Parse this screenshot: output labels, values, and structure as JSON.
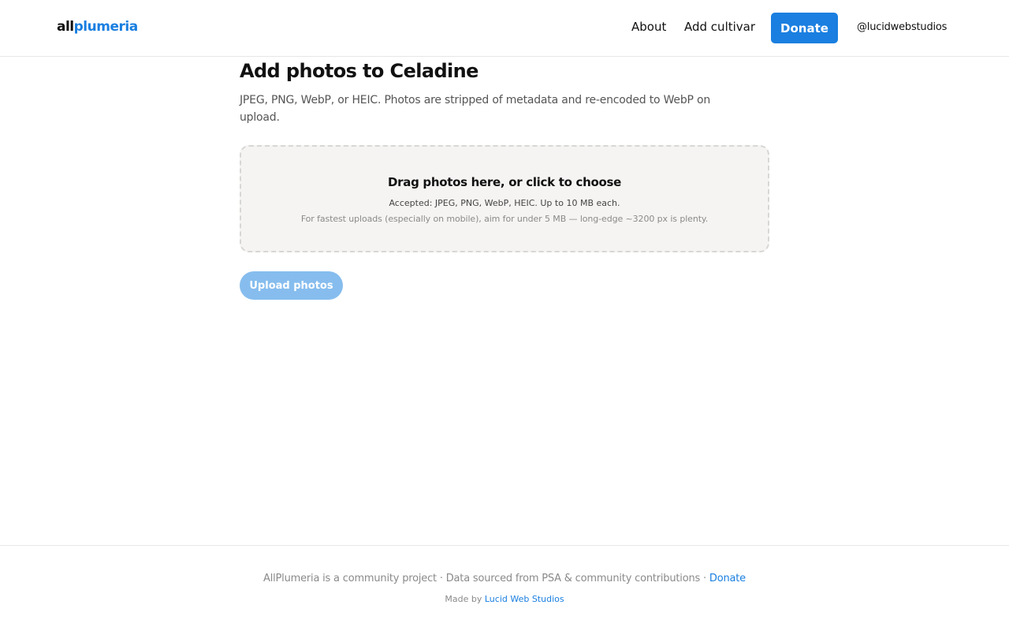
{
  "header": {
    "logo_prefix": "all",
    "logo_brand": "plumeria",
    "nav": {
      "about": "About",
      "add_cultivar": "Add cultivar",
      "donate": "Donate"
    },
    "user_handle": "@lucidwebstudios"
  },
  "main": {
    "title": "Add photos to Celadine",
    "description": "JPEG, PNG, WebP, or HEIC. Photos are stripped of metadata and re-encoded to WebP on upload.",
    "dropzone": {
      "title": "Drag photos here, or click to choose",
      "accepted": "Accepted: JPEG, PNG, WebP, HEIC. Up to 10 MB each.",
      "hint": "For fastest uploads (especially on mobile), aim for under 5 MB — long-edge ~3200 px is plenty."
    },
    "upload_button": "Upload photos"
  },
  "footer": {
    "community_text": "AllPlumeria is a community project",
    "separator": "·",
    "data_source_text": "Data sourced from PSA & community contributions",
    "donate_link": "Donate",
    "made_by_prefix": "Made by",
    "made_by_link": "Lucid Web Studios"
  },
  "colors": {
    "accent": "#1a7fe0",
    "accent_disabled": "#86bdee",
    "dropzone_bg": "#f5f4f2",
    "border": "#e6e6e6"
  }
}
